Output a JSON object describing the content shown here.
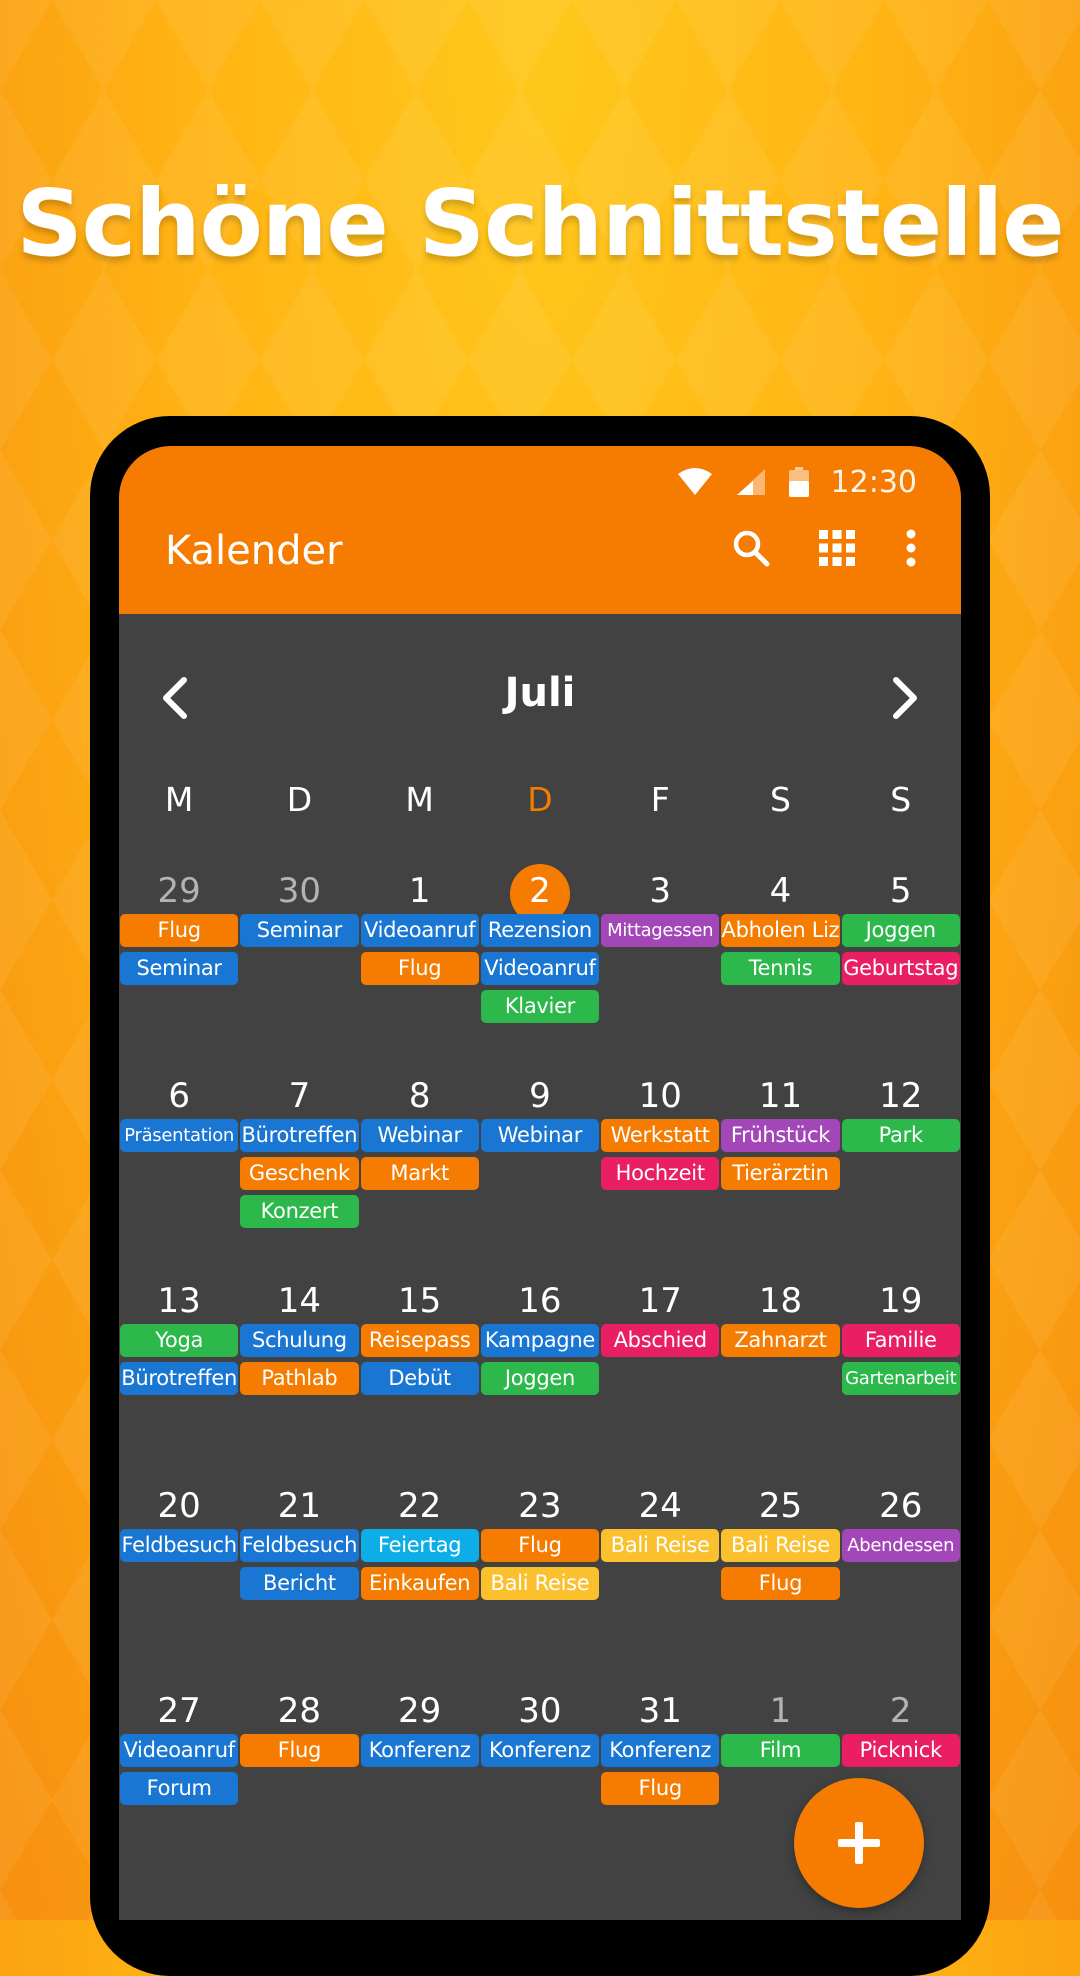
{
  "headline": "Schöne Schnittstelle",
  "status": {
    "time": "12:30"
  },
  "appbar": {
    "title": "Kalender",
    "icons": [
      "search-icon",
      "grid-view-icon",
      "more-vertical-icon"
    ],
    "color": "#f57c00"
  },
  "month": {
    "title": "Juli"
  },
  "weekdays": [
    "M",
    "D",
    "M",
    "D",
    "F",
    "S",
    "S"
  ],
  "today_index": 3,
  "colors": {
    "orange": "#f57c00",
    "blue": "#1976d2",
    "green": "#2db84b",
    "purple": "#a347b8",
    "pink": "#e91e63",
    "cyan": "#0daee8",
    "yellow": "#fbc02d"
  },
  "weeks": [
    [
      {
        "n": "29",
        "muted": true,
        "events": [
          {
            "t": "Flug",
            "c": "orange"
          },
          {
            "t": "Seminar",
            "c": "blue"
          }
        ]
      },
      {
        "n": "30",
        "muted": true,
        "events": [
          {
            "t": "Seminar",
            "c": "blue"
          }
        ]
      },
      {
        "n": "1",
        "events": [
          {
            "t": "Videoanruf",
            "c": "blue"
          },
          {
            "t": "Flug",
            "c": "orange"
          }
        ]
      },
      {
        "n": "2",
        "today": true,
        "events": [
          {
            "t": "Rezension",
            "c": "blue"
          },
          {
            "t": "Videoanruf",
            "c": "blue"
          },
          {
            "t": "Klavier",
            "c": "green"
          }
        ]
      },
      {
        "n": "3",
        "events": [
          {
            "t": "Mittagessen",
            "c": "purple",
            "small": true
          }
        ]
      },
      {
        "n": "4",
        "events": [
          {
            "t": "Abholen Liz",
            "c": "orange"
          },
          {
            "t": "Tennis",
            "c": "green"
          }
        ]
      },
      {
        "n": "5",
        "events": [
          {
            "t": "Joggen",
            "c": "green"
          },
          {
            "t": "Geburtstag",
            "c": "pink"
          }
        ]
      }
    ],
    [
      {
        "n": "6",
        "events": [
          {
            "t": "Präsentation",
            "c": "blue",
            "small": true
          }
        ]
      },
      {
        "n": "7",
        "events": [
          {
            "t": "Bürotreffen",
            "c": "blue"
          },
          {
            "t": "Geschenk",
            "c": "orange"
          },
          {
            "t": "Konzert",
            "c": "green"
          }
        ]
      },
      {
        "n": "8",
        "events": [
          {
            "t": "Webinar",
            "c": "blue"
          },
          {
            "t": "Markt",
            "c": "orange"
          }
        ]
      },
      {
        "n": "9",
        "events": [
          {
            "t": "Webinar",
            "c": "blue"
          }
        ]
      },
      {
        "n": "10",
        "events": [
          {
            "t": "Werkstatt",
            "c": "orange"
          },
          {
            "t": "Hochzeit",
            "c": "pink"
          }
        ]
      },
      {
        "n": "11",
        "events": [
          {
            "t": "Frühstück",
            "c": "purple"
          },
          {
            "t": "Tierärztin",
            "c": "orange"
          }
        ]
      },
      {
        "n": "12",
        "events": [
          {
            "t": "Park",
            "c": "green"
          }
        ]
      }
    ],
    [
      {
        "n": "13",
        "events": [
          {
            "t": "Yoga",
            "c": "green"
          },
          {
            "t": "Bürotreffen",
            "c": "blue"
          }
        ]
      },
      {
        "n": "14",
        "events": [
          {
            "t": "Schulung",
            "c": "blue"
          },
          {
            "t": "Pathlab",
            "c": "orange"
          }
        ]
      },
      {
        "n": "15",
        "events": [
          {
            "t": "Reisepass",
            "c": "orange"
          },
          {
            "t": "Debüt",
            "c": "blue"
          }
        ]
      },
      {
        "n": "16",
        "events": [
          {
            "t": "Kampagne",
            "c": "blue"
          },
          {
            "t": "Joggen",
            "c": "green"
          }
        ]
      },
      {
        "n": "17",
        "events": [
          {
            "t": "Abschied",
            "c": "pink"
          }
        ]
      },
      {
        "n": "18",
        "events": [
          {
            "t": "Zahnarzt",
            "c": "orange"
          }
        ]
      },
      {
        "n": "19",
        "events": [
          {
            "t": "Familie",
            "c": "pink"
          },
          {
            "t": "Gartenarbeit",
            "c": "green",
            "small": true
          }
        ]
      }
    ],
    [
      {
        "n": "20",
        "events": [
          {
            "t": "Feldbesuch",
            "c": "blue"
          }
        ]
      },
      {
        "n": "21",
        "events": [
          {
            "t": "Feldbesuch",
            "c": "blue"
          },
          {
            "t": "Bericht",
            "c": "blue"
          }
        ]
      },
      {
        "n": "22",
        "events": [
          {
            "t": "Feiertag",
            "c": "cyan"
          },
          {
            "t": "Einkaufen",
            "c": "orange"
          }
        ]
      },
      {
        "n": "23",
        "events": [
          {
            "t": "Flug",
            "c": "orange"
          },
          {
            "t": "Bali Reise",
            "c": "yellow"
          }
        ]
      },
      {
        "n": "24",
        "events": [
          {
            "t": "Bali Reise",
            "c": "yellow"
          }
        ]
      },
      {
        "n": "25",
        "events": [
          {
            "t": "Bali Reise",
            "c": "yellow"
          },
          {
            "t": "Flug",
            "c": "orange"
          }
        ]
      },
      {
        "n": "26",
        "events": [
          {
            "t": "Abendessen",
            "c": "purple",
            "small": true
          }
        ]
      }
    ],
    [
      {
        "n": "27",
        "events": [
          {
            "t": "Videoanruf",
            "c": "blue"
          },
          {
            "t": "Forum",
            "c": "blue"
          }
        ]
      },
      {
        "n": "28",
        "events": [
          {
            "t": "Flug",
            "c": "orange"
          }
        ]
      },
      {
        "n": "29",
        "events": [
          {
            "t": "Konferenz",
            "c": "blue"
          }
        ]
      },
      {
        "n": "30",
        "events": [
          {
            "t": "Konferenz",
            "c": "blue"
          }
        ]
      },
      {
        "n": "31",
        "events": [
          {
            "t": "Konferenz",
            "c": "blue"
          },
          {
            "t": "Flug",
            "c": "orange"
          }
        ]
      },
      {
        "n": "1",
        "muted": true,
        "events": [
          {
            "t": "Film",
            "c": "green"
          }
        ]
      },
      {
        "n": "2",
        "muted": true,
        "events": [
          {
            "t": "Picknick",
            "c": "pink"
          }
        ]
      }
    ]
  ],
  "fab": {
    "icon": "plus-icon"
  }
}
